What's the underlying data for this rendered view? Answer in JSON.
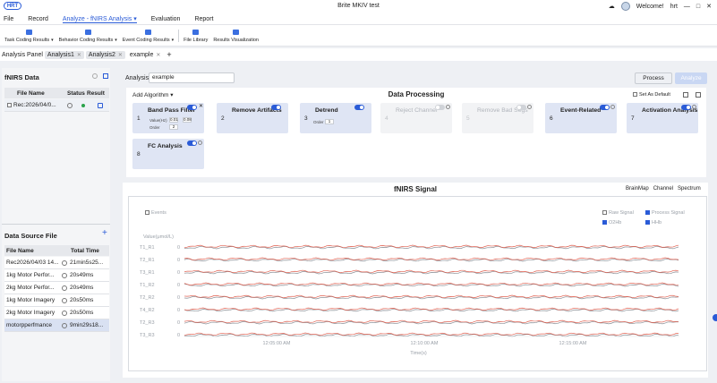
{
  "titlebar": {
    "logo": "HRT",
    "title": "Brite MKIV test",
    "welcome": "Welcome!",
    "user": "hrt",
    "min": "—",
    "max": "□",
    "close": "✕"
  },
  "menu": {
    "file": "File",
    "record": "Record",
    "analyze": "Analyze - fNIRS Analysis",
    "evaluation": "Evaluation",
    "report": "Report"
  },
  "toolbar": {
    "task": "Task Coding Results",
    "behavior": "Behavior Coding Results",
    "event": "Event Coding Results",
    "library": "File Library",
    "viz": "Results Visualization"
  },
  "tabs": {
    "panel": "Analysis Panel",
    "a1": "Analysis1",
    "a2": "Analysis2",
    "ex": "example",
    "add": "+"
  },
  "fnirs": {
    "title": "fNIRS Data",
    "col_file": "File Name",
    "col_status": "Status",
    "col_result": "Result",
    "row_file": "Rec:2026/04/0..."
  },
  "datasource": {
    "title": "Data Source File",
    "add": "+",
    "col_file": "File Name",
    "col_time": "Total Time",
    "rows": [
      {
        "name": "Rec2026/04/03 14...",
        "time": "21min5s25..."
      },
      {
        "name": "1kg Motor Perfor...",
        "time": "20s49ms"
      },
      {
        "name": "2kg Motor Perfor...",
        "time": "20s49ms"
      },
      {
        "name": "1kg Motor Imagery",
        "time": "20s50ms"
      },
      {
        "name": "2kg Motor Imagery",
        "time": "20s50ms"
      },
      {
        "name": "motorpperfmance",
        "time": "9min29s18..."
      }
    ]
  },
  "analysis": {
    "label": "Analysis",
    "value": "example",
    "process": "Process",
    "analyze": "Analyze"
  },
  "processing": {
    "add_algorithm": "Add Algorithm",
    "title": "Data Processing",
    "set_default": "Set As Default",
    "cards": [
      {
        "num": "1",
        "title": "Band Pass Filter",
        "enabled": true
      },
      {
        "num": "2",
        "title": "Remove Artifacts",
        "enabled": true
      },
      {
        "num": "3",
        "title": "Detrend",
        "enabled": true
      },
      {
        "num": "4",
        "title": "Reject Channel",
        "enabled": false
      },
      {
        "num": "5",
        "title": "Remove Bad Segs",
        "enabled": false
      },
      {
        "num": "6",
        "title": "Event-Related",
        "enabled": true
      },
      {
        "num": "7",
        "title": "Activation Analysis",
        "enabled": true
      },
      {
        "num": "8",
        "title": "FC Analysis",
        "enabled": true
      }
    ],
    "bpf": {
      "value_label": "Value(Hz)",
      "low": "0.01",
      "high": "0.08",
      "order_label": "Order",
      "order": "2"
    },
    "detrend": {
      "order_label": "Order",
      "order": "1"
    }
  },
  "signal": {
    "title": "fNIRS Signal",
    "views": {
      "brainmap": "BrainMap",
      "channel": "Channel",
      "spectrum": "Spectrum"
    },
    "events": "Events",
    "raw": "Raw Signal",
    "processed": "Process Signal",
    "o2hb": "O2Hb",
    "hhb": "HHb",
    "ylabel": "Value(μmol/L)",
    "xlabel": "Time(s)",
    "channels": [
      "T1_R1",
      "T2_R1",
      "T3_R1",
      "T1_R2",
      "T2_R2",
      "T4_R2",
      "T2_R3",
      "T3_R3"
    ],
    "zero": "0",
    "xticks": [
      "12:05:00 AM",
      "12:10:00 AM",
      "12:15:00 AM"
    ]
  },
  "chart_data": {
    "type": "line",
    "xlabel": "Time(s)",
    "ylabel": "Value(μmol/L)",
    "categories": [
      "12:05:00 AM",
      "12:10:00 AM",
      "12:15:00 AM"
    ],
    "series_colors": {
      "o2hb": "#e06050",
      "hhb": "#8a8f96"
    }
  }
}
